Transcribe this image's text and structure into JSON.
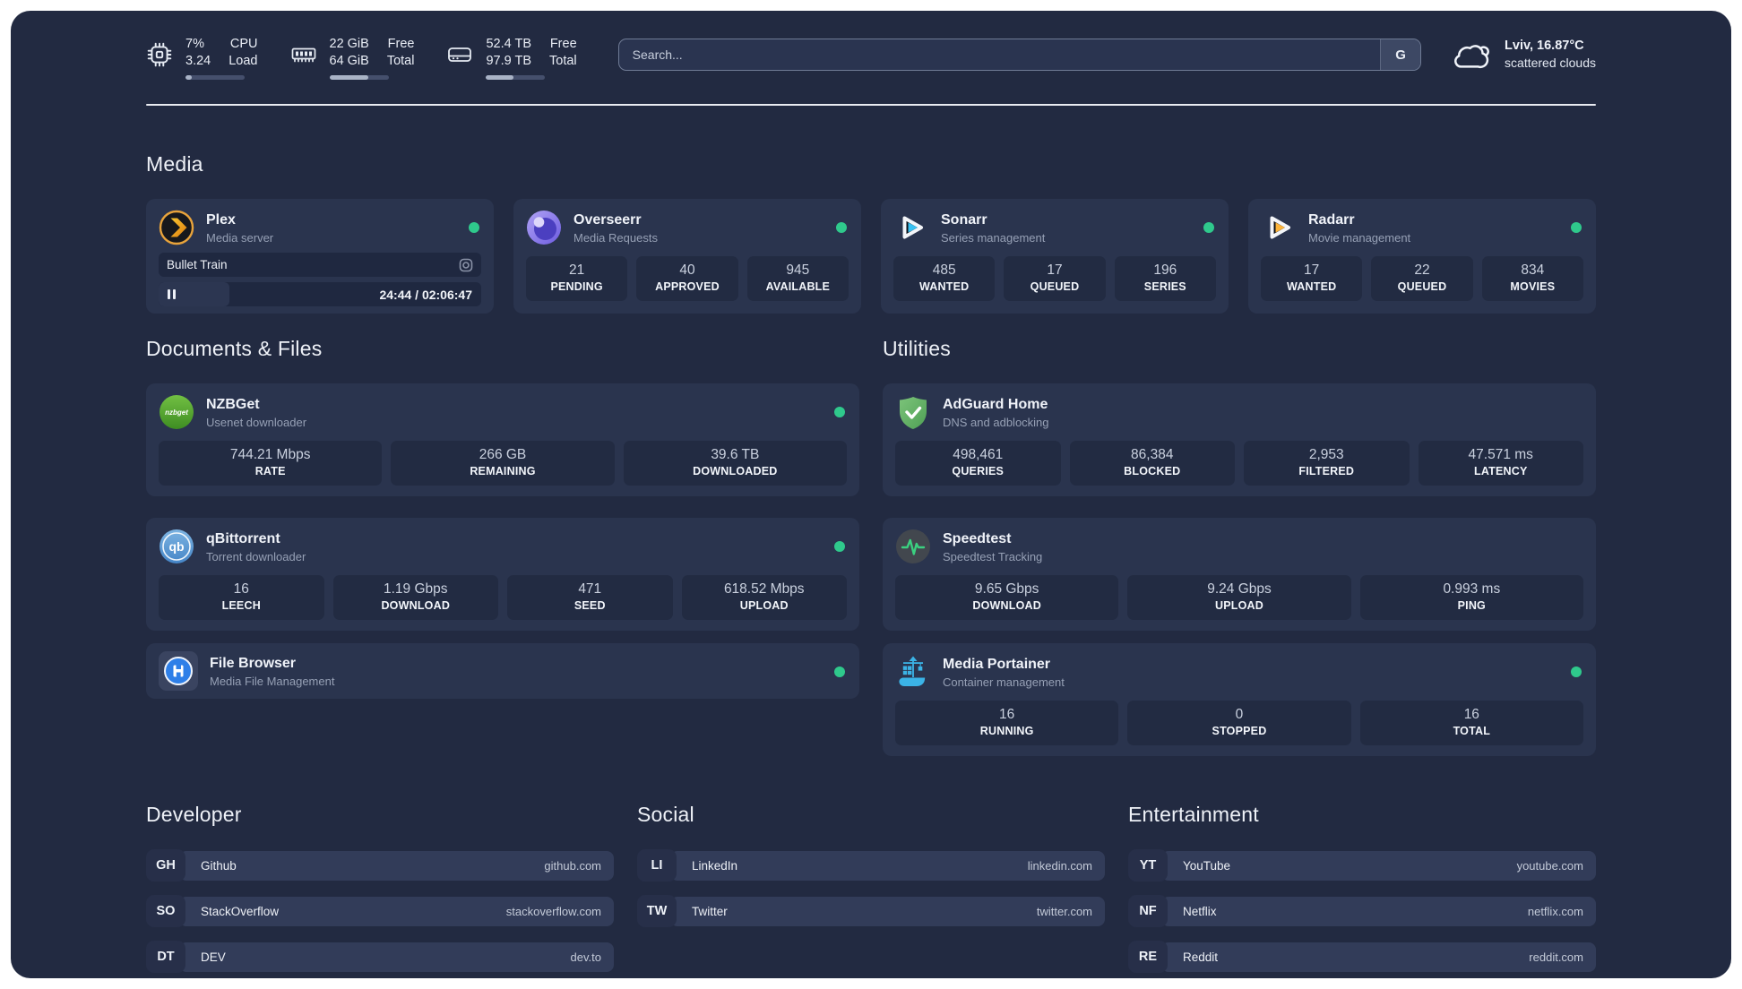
{
  "header": {
    "metrics": [
      {
        "icon": "cpu-icon",
        "top_value": "7%",
        "bottom_value": "3.24",
        "top_label": "CPU",
        "bottom_label": "Load",
        "progress_pct": 10
      },
      {
        "icon": "ram-icon",
        "top_value": "22 GiB",
        "bottom_value": "64 GiB",
        "top_label": "Free",
        "bottom_label": "Total",
        "progress_pct": 66
      },
      {
        "icon": "disk-icon",
        "top_value": "52.4 TB",
        "bottom_value": "97.9 TB",
        "top_label": "Free",
        "bottom_label": "Total",
        "progress_pct": 46
      }
    ],
    "search": {
      "placeholder": "Search...",
      "engine_button_label": "G"
    },
    "weather": {
      "icon": "cloud-icon",
      "location_temperature": "Lviv, 16.87°C",
      "condition": "scattered clouds"
    }
  },
  "sections": {
    "media": {
      "title": "Media",
      "plex": {
        "name": "Plex",
        "description": "Media server",
        "online": true,
        "now_playing_title": "Bullet Train",
        "elapsed_total": "24:44 / 02:06:47",
        "progress_pct": 22
      },
      "overseerr": {
        "name": "Overseerr",
        "description": "Media Requests",
        "online": true,
        "stats": [
          {
            "value": "21",
            "label": "PENDING"
          },
          {
            "value": "40",
            "label": "APPROVED"
          },
          {
            "value": "945",
            "label": "AVAILABLE"
          }
        ]
      },
      "sonarr": {
        "name": "Sonarr",
        "description": "Series management",
        "online": true,
        "stats": [
          {
            "value": "485",
            "label": "WANTED"
          },
          {
            "value": "17",
            "label": "QUEUED"
          },
          {
            "value": "196",
            "label": "SERIES"
          }
        ]
      },
      "radarr": {
        "name": "Radarr",
        "description": "Movie management",
        "online": true,
        "stats": [
          {
            "value": "17",
            "label": "WANTED"
          },
          {
            "value": "22",
            "label": "QUEUED"
          },
          {
            "value": "834",
            "label": "MOVIES"
          }
        ]
      }
    },
    "documents": {
      "title": "Documents & Files",
      "nzbget": {
        "name": "NZBGet",
        "description": "Usenet downloader",
        "icon_text": "nzbget",
        "online": true,
        "stats": [
          {
            "value": "744.21 Mbps",
            "label": "RATE"
          },
          {
            "value": "266 GB",
            "label": "REMAINING"
          },
          {
            "value": "39.6 TB",
            "label": "DOWNLOADED"
          }
        ]
      },
      "qbittorrent": {
        "name": "qBittorrent",
        "description": "Torrent downloader",
        "icon_text": "qb",
        "online": true,
        "stats": [
          {
            "value": "16",
            "label": "LEECH"
          },
          {
            "value": "1.19 Gbps",
            "label": "DOWNLOAD"
          },
          {
            "value": "471",
            "label": "SEED"
          },
          {
            "value": "618.52 Mbps",
            "label": "UPLOAD"
          }
        ]
      },
      "filebrowser": {
        "name": "File Browser",
        "description": "Media File Management",
        "online": true
      }
    },
    "utilities": {
      "title": "Utilities",
      "adguard": {
        "name": "AdGuard Home",
        "description": "DNS and adblocking",
        "stats": [
          {
            "value": "498,461",
            "label": "QUERIES"
          },
          {
            "value": "86,384",
            "label": "BLOCKED"
          },
          {
            "value": "2,953",
            "label": "FILTERED"
          },
          {
            "value": "47.571 ms",
            "label": "LATENCY"
          }
        ]
      },
      "speedtest": {
        "name": "Speedtest",
        "description": "Speedtest Tracking",
        "stats": [
          {
            "value": "9.65 Gbps",
            "label": "DOWNLOAD"
          },
          {
            "value": "9.24 Gbps",
            "label": "UPLOAD"
          },
          {
            "value": "0.993 ms",
            "label": "PING"
          }
        ]
      },
      "portainer": {
        "name": "Media Portainer",
        "description": "Container management",
        "online": true,
        "stats": [
          {
            "value": "16",
            "label": "RUNNING"
          },
          {
            "value": "0",
            "label": "STOPPED"
          },
          {
            "value": "16",
            "label": "TOTAL"
          }
        ]
      }
    },
    "links": {
      "developer": {
        "title": "Developer",
        "items": [
          {
            "badge": "GH",
            "name": "Github",
            "url": "github.com"
          },
          {
            "badge": "SO",
            "name": "StackOverflow",
            "url": "stackoverflow.com"
          },
          {
            "badge": "DT",
            "name": "DEV",
            "url": "dev.to"
          }
        ]
      },
      "social": {
        "title": "Social",
        "items": [
          {
            "badge": "LI",
            "name": "LinkedIn",
            "url": "linkedin.com"
          },
          {
            "badge": "TW",
            "name": "Twitter",
            "url": "twitter.com"
          }
        ]
      },
      "entertainment": {
        "title": "Entertainment",
        "items": [
          {
            "badge": "YT",
            "name": "YouTube",
            "url": "youtube.com"
          },
          {
            "badge": "NF",
            "name": "Netflix",
            "url": "netflix.com"
          },
          {
            "badge": "RE",
            "name": "Reddit",
            "url": "reddit.com"
          }
        ]
      }
    }
  },
  "colors": {
    "dashboard_bg": "#222a41",
    "card_bg": "#2a344e",
    "tile_bg": "#222b42",
    "status_online": "#2fc98c",
    "plex_accent": "#e8a33b",
    "sonarr_accent": "#38c1f2",
    "radarr_accent": "#fcb43b",
    "nzbget_accent": "#54a12f",
    "qbittorrent_accent": "#5b9bd5",
    "adguard_accent": "#63b265",
    "speedtest_accent": "#3bd080",
    "portainer_accent": "#3bb3e6",
    "filebrowser_accent": "#2e7fe8",
    "overseerr_accent": "#8b7ae8"
  }
}
